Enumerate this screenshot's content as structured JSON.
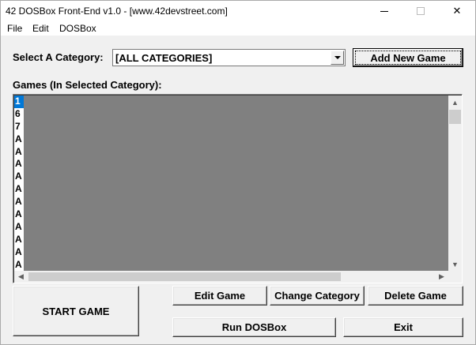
{
  "window": {
    "title": "42 DOSBox Front-End v1.0 - [www.42devstreet.com]",
    "close_glyph": "✕"
  },
  "menu": {
    "items": [
      "File",
      "Edit",
      "DOSBox"
    ]
  },
  "category": {
    "label": "Select A Category:",
    "selected": "[ALL CATEGORIES]"
  },
  "buttons": {
    "add_new_game": "Add New Game",
    "start_game": "START GAME",
    "edit_game": "Edit Game",
    "change_category": "Change Category",
    "delete_game": "Delete Game",
    "run_dosbox": "Run DOSBox",
    "exit": "Exit"
  },
  "games": {
    "label": "Games (In Selected Category):",
    "items": [
      "1",
      "6",
      "7",
      "A",
      "A",
      "A",
      "A",
      "A",
      "A",
      "A",
      "A",
      "A",
      "A",
      "A"
    ],
    "selected_index": 0
  },
  "scroll": {
    "up": "▲",
    "down": "▼",
    "left": "◀",
    "right": "▶"
  },
  "colors": {
    "selection": "#0078d7",
    "list_background": "#808080",
    "window_background": "#f0f0f0"
  }
}
